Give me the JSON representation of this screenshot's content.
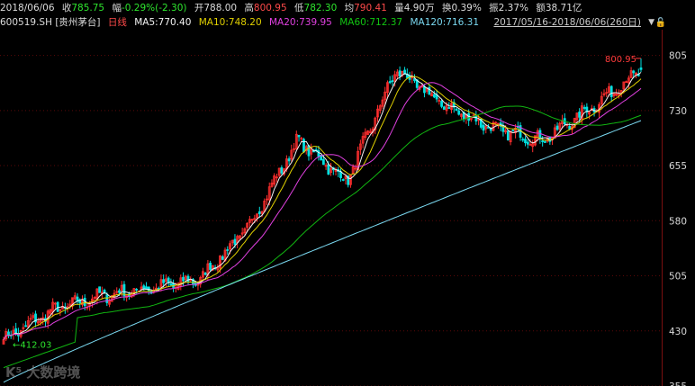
{
  "header": {
    "date": "2018/06/06",
    "close_label": "收",
    "close_value": "785.75",
    "change_label": "幅",
    "change_value": "-0.29%(-2.30)",
    "open_label": "开",
    "open_value": "788.00",
    "high_label": "高",
    "high_value": "800.95",
    "low_label": "低",
    "low_value": "782.30",
    "avg_label": "均",
    "avg_value": "790.41",
    "volume_label": "量",
    "volume_value": "4.90万",
    "turnover_label": "换",
    "turnover_value": "0.39%",
    "amplitude_label": "振",
    "amplitude_value": "2.37%",
    "amount_label": "额",
    "amount_value": "38.71亿",
    "range_text": "2017/05/16-2018/06/06(260日)",
    "range_dropdown_icon": "triangle-down-icon",
    "lock_icon": "lock-icon"
  },
  "legend": {
    "symbol": "600519.SH [贵州茅台]",
    "period": "日线",
    "ma5_text": "MA5:770.40",
    "ma10_text": "MA10:748.20",
    "ma20_text": "MA20:739.95",
    "ma60_text": "MA60:712.37",
    "ma120_text": "MA120:716.31"
  },
  "colors": {
    "up": "#ff2e2e",
    "down": "#00e0e0",
    "ma5": "#f4f4f4",
    "ma10": "#e0d000",
    "ma20": "#e040e0",
    "ma60": "#11b511",
    "ma120": "#7ad8f0",
    "axis_text": "#d8d8d8",
    "grid": "#5a0808",
    "annotation_high": "#ff3b3b",
    "annotation_low": "#2ee62e"
  },
  "watermark": "大数跨境",
  "chart_data": {
    "type": "candlestick",
    "title": "600519.SH [贵州茅台] 日线",
    "x_range": [
      "2017/05/16",
      "2018/06/06"
    ],
    "ylim": [
      355,
      840
    ],
    "y_ticks": [
      355,
      430,
      505,
      580,
      655,
      730,
      805
    ],
    "annotations": {
      "high": "800.95",
      "low": "412.03"
    },
    "ohlc_anchors": [
      {
        "x": "2017/05/16",
        "open": 412.0,
        "high": 422.0,
        "low": 412.03,
        "close": 418.0
      },
      {
        "x": "2017/06",
        "close": 458.0
      },
      {
        "x": "2017/07",
        "close": 478.0
      },
      {
        "x": "2017/08",
        "close": 488.0
      },
      {
        "x": "2017/09",
        "close": 500.0
      },
      {
        "x": "2017/10",
        "close": 572.0
      },
      {
        "x": "2017/11",
        "close": 690.0
      },
      {
        "x": "2017/12",
        "close": 633.0
      },
      {
        "x": "2018/01",
        "close": 785.0
      },
      {
        "x": "2018/02",
        "close": 737.0
      },
      {
        "x": "2018/03",
        "close": 705.0
      },
      {
        "x": "2018/04",
        "close": 690.0
      },
      {
        "x": "2018/05",
        "close": 735.0
      },
      {
        "x": "2018/06/06",
        "open": 788.0,
        "high": 800.95,
        "low": 782.3,
        "close": 785.75
      }
    ],
    "series": [
      {
        "name": "MA5",
        "last": 770.4
      },
      {
        "name": "MA10",
        "last": 748.2
      },
      {
        "name": "MA20",
        "last": 739.95
      },
      {
        "name": "MA60",
        "last": 712.37
      },
      {
        "name": "MA120",
        "last": 716.31
      }
    ]
  }
}
